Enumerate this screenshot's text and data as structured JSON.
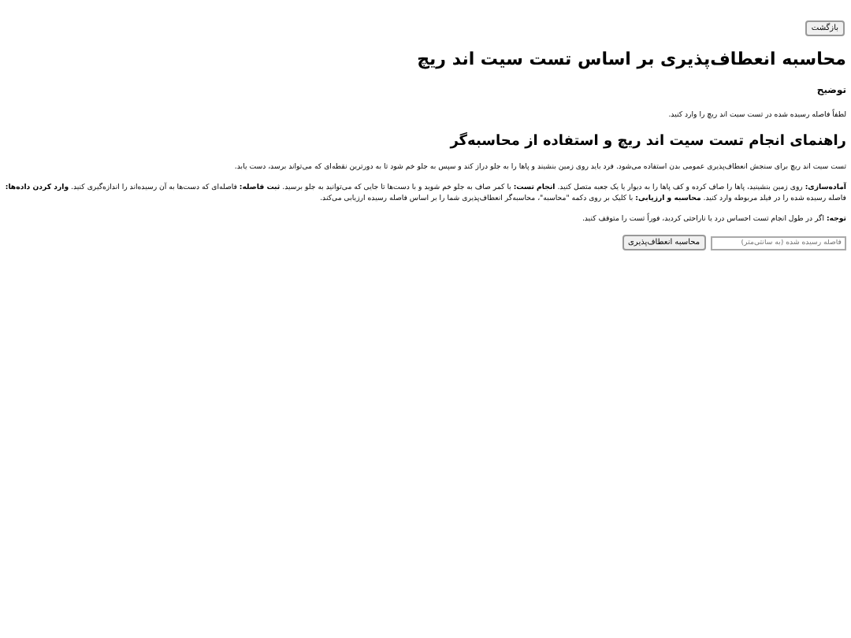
{
  "back_button": "بازگشت",
  "title": "محاسبه انعطاف‌پذیری بر اساس تست سیت اند ریچ",
  "description": {
    "heading": "توضیح",
    "text": "لطفاً فاصله رسیده شده در تست سیت اند ریچ را وارد کنید."
  },
  "guide": {
    "heading": "راهنمای انجام تست سیت اند ریچ و استفاده از محاسبه‌گر",
    "paragraphs": [
      "تست سیت اند ریچ برای سنجش انعطاف‌پذیری عمومی بدن استفاده می‌شود. فرد باید روی زمین بنشیند و پاها را به جلو دراز کند و سپس به جلو خم شود تا به دورترین نقطه‌ای که می‌تواند برسد، دست یابد.",
      "**آماده‌سازی:** روی زمین بنشینید، پاها را صاف کرده و کف پاها را به دیوار یا یک جعبه متصل کنید. **انجام تست:** با کمر صاف به جلو خم شوید و با دست‌ها تا جایی که می‌توانید به جلو برسید. **ثبت فاصله:** فاصله‌ای که دست‌ها به آن رسیده‌اند را اندازه‌گیری کنید. **وارد کردن داده‌ها:** فاصله رسیده شده را در فیلد مربوطه وارد کنید. **محاسبه و ارزیابی:** با کلیک بر روی دکمه \"محاسبه\"، محاسبه‌گر انعطاف‌پذیری شما را بر اساس فاصله رسیده ارزیابی می‌کند.",
      "**توجه:** اگر در طول انجام تست احساس درد یا ناراحتی کردید، فوراً تست را متوقف کنید."
    ]
  },
  "form": {
    "placeholder": "فاصله رسیده شده (به سانتی‌متر)",
    "button": "محاسبه انعطاف‌پذیری"
  }
}
